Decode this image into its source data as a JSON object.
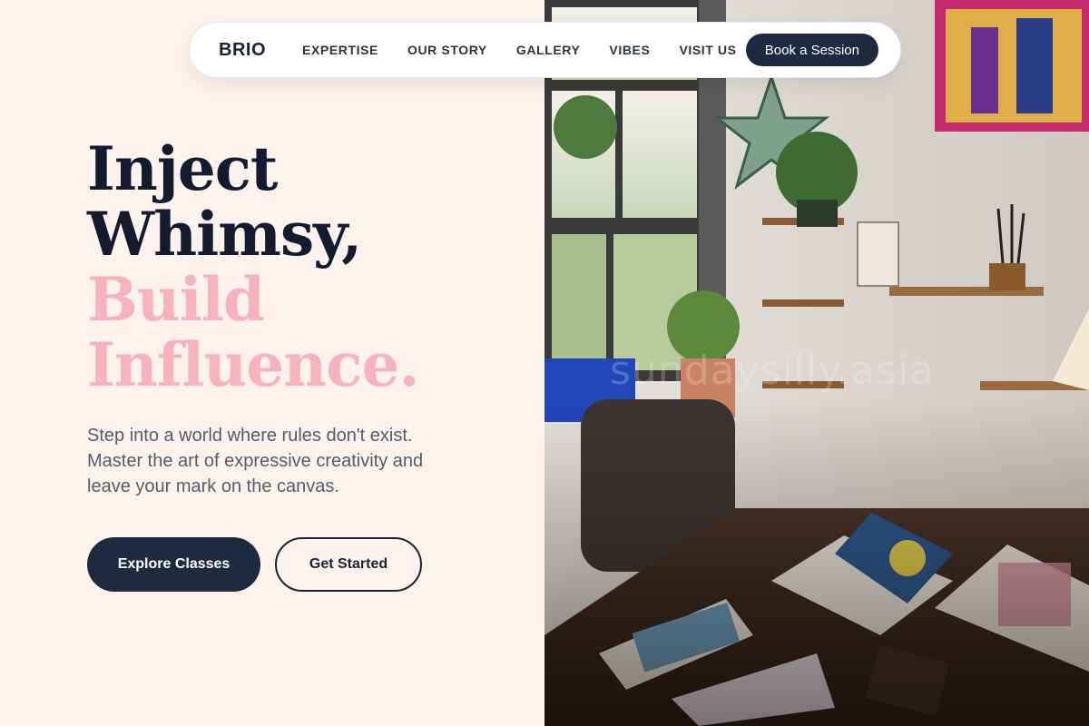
{
  "nav": {
    "brand": "BRIO",
    "links": [
      "EXPERTISE",
      "OUR STORY",
      "GALLERY",
      "VIBES",
      "VISIT US"
    ],
    "cta": "Book a Session"
  },
  "hero": {
    "headline_line1": "Inject",
    "headline_line2": "Whimsy,",
    "headline_line3": "Build",
    "headline_line4": "Influence.",
    "subtext": "Step into a world where rules don't exist. Master the art of expressive creativity and leave your mark on the canvas.",
    "primary_button": "Explore Classes",
    "secondary_button": "Get Started"
  },
  "photo": {
    "watermark": "sundaysilly.asia"
  },
  "colors": {
    "background": "#fdf3ec",
    "navy": "#1e2a3d",
    "headline_dark": "#141b2e",
    "headline_pink": "#f6b3bf",
    "body_text": "#555c6a"
  }
}
